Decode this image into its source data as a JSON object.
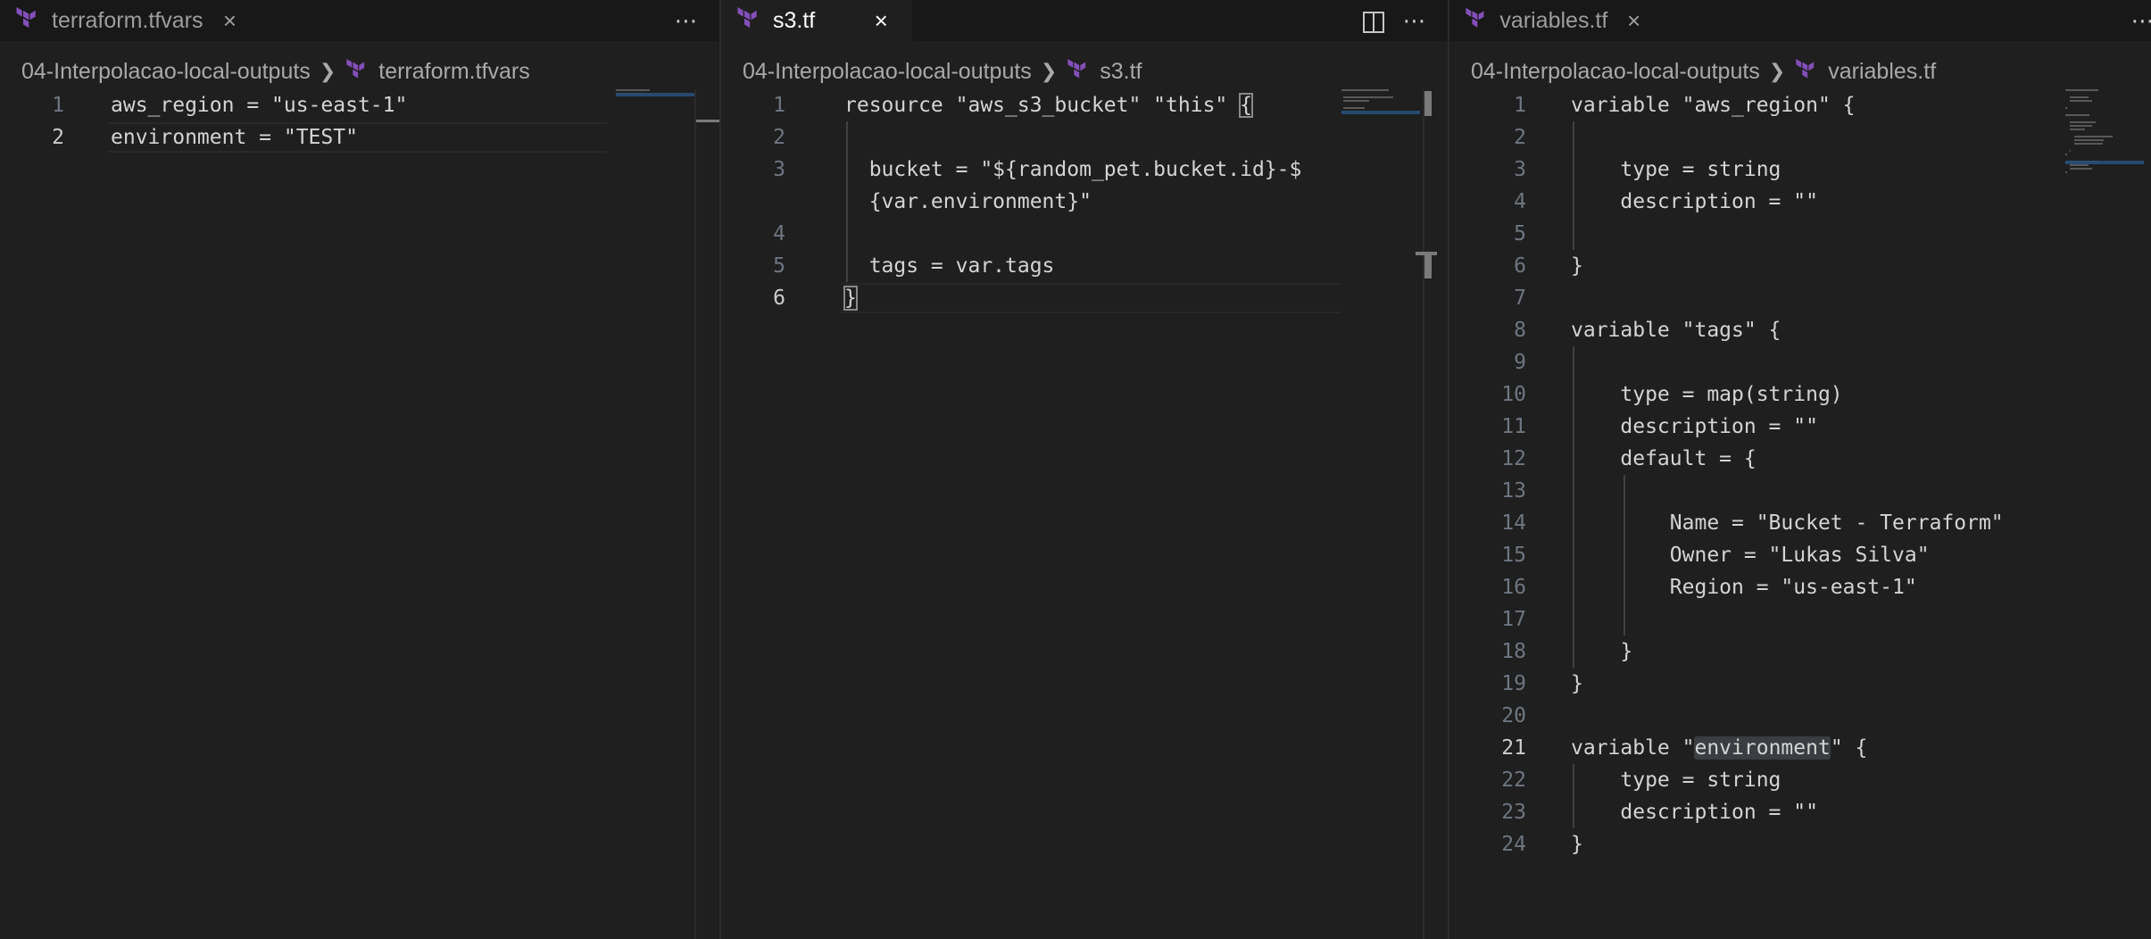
{
  "panes": [
    {
      "tab": {
        "label": "terraform.tfvars",
        "close": "×"
      },
      "actions": [
        "⋯"
      ],
      "breadcrumb": {
        "folder": "04-Interpolacao-local-outputs",
        "file": "terraform.tfvars"
      },
      "current_line": 2,
      "lines": [
        {
          "n": "1",
          "text": "aws_region = \"us-east-1\""
        },
        {
          "n": "2",
          "text": "environment = \"TEST\""
        }
      ]
    },
    {
      "tab": {
        "label": "s3.tf",
        "close": "×"
      },
      "actions": [
        "split-editor-icon",
        "⋯"
      ],
      "breadcrumb": {
        "folder": "04-Interpolacao-local-outputs",
        "file": "s3.tf"
      },
      "current_line": 6,
      "lines": [
        {
          "n": "1",
          "text": "resource \"aws_s3_bucket\" \"this\" {"
        },
        {
          "n": "2",
          "text": ""
        },
        {
          "n": "3",
          "text": "  bucket = \"${random_pet.bucket.id}-$"
        },
        {
          "n": "",
          "text": "  {var.environment}\""
        },
        {
          "n": "4",
          "text": ""
        },
        {
          "n": "5",
          "text": "  tags = var.tags"
        },
        {
          "n": "6",
          "text": "}"
        }
      ]
    },
    {
      "tab": {
        "label": "variables.tf",
        "close": "×"
      },
      "actions": [
        "⋯"
      ],
      "breadcrumb": {
        "folder": "04-Interpolacao-local-outputs",
        "file": "variables.tf"
      },
      "current_line": 21,
      "lines": [
        {
          "n": "1",
          "text": "variable \"aws_region\" {"
        },
        {
          "n": "2",
          "text": ""
        },
        {
          "n": "3",
          "text": "    type = string"
        },
        {
          "n": "4",
          "text": "    description = \"\""
        },
        {
          "n": "5",
          "text": ""
        },
        {
          "n": "6",
          "text": "}"
        },
        {
          "n": "7",
          "text": ""
        },
        {
          "n": "8",
          "text": "variable \"tags\" {"
        },
        {
          "n": "9",
          "text": ""
        },
        {
          "n": "10",
          "text": "    type = map(string)"
        },
        {
          "n": "11",
          "text": "    description = \"\""
        },
        {
          "n": "12",
          "text": "    default = {"
        },
        {
          "n": "13",
          "text": ""
        },
        {
          "n": "14",
          "text": "        Name = \"Bucket - Terraform\""
        },
        {
          "n": "15",
          "text": "        Owner = \"Lukas Silva\""
        },
        {
          "n": "16",
          "text": "        Region = \"us-east-1\""
        },
        {
          "n": "17",
          "text": ""
        },
        {
          "n": "18",
          "text": "    }"
        },
        {
          "n": "19",
          "text": "}"
        },
        {
          "n": "20",
          "text": ""
        },
        {
          "n": "21",
          "text": "variable \"environment\" {"
        },
        {
          "n": "22",
          "text": "    type = string"
        },
        {
          "n": "23",
          "text": "    description = \"\""
        },
        {
          "n": "24",
          "text": "}"
        }
      ]
    }
  ],
  "colors": {
    "terraform_icon": "#844fba",
    "background": "#1f1f1f",
    "tabbar": "#181818"
  }
}
